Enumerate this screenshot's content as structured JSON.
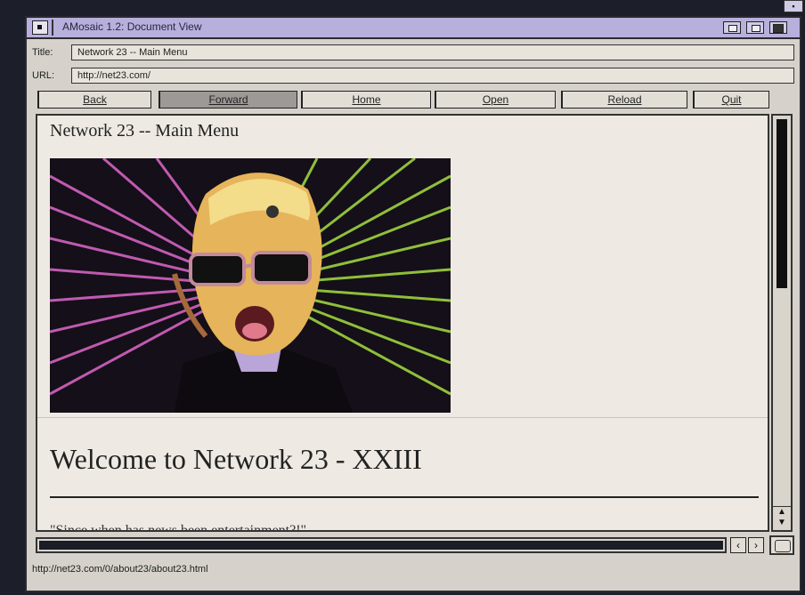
{
  "window": {
    "title": "AMosaic 1.2: Document View"
  },
  "nav": {
    "title_label": "Title:",
    "title_value": "Network 23 -- Main Menu",
    "url_label": "URL:",
    "url_value": "http://net23.com/"
  },
  "toolbar": {
    "buttons": [
      {
        "label": "Back",
        "state": "normal"
      },
      {
        "label": "Forward",
        "state": "pressed"
      },
      {
        "label": "Home",
        "state": "normal"
      },
      {
        "label": "Open",
        "state": "normal"
      },
      {
        "label": "Reload",
        "state": "normal"
      },
      {
        "label": "Quit",
        "state": "normal"
      }
    ]
  },
  "document": {
    "heading": "Network 23 -- Main Menu",
    "image_icon": "max-headroom-image",
    "welcome": "Welcome to Network 23 - XXIII",
    "quote_partial": "\"Since when has news been entertainment?!\""
  },
  "status": {
    "text": "http://net23.com/0/about23/about23.html"
  },
  "colors": {
    "titlebar": "#b7b0dc",
    "window_bg": "#d6d2cb",
    "content_bg": "#eeeae3"
  }
}
